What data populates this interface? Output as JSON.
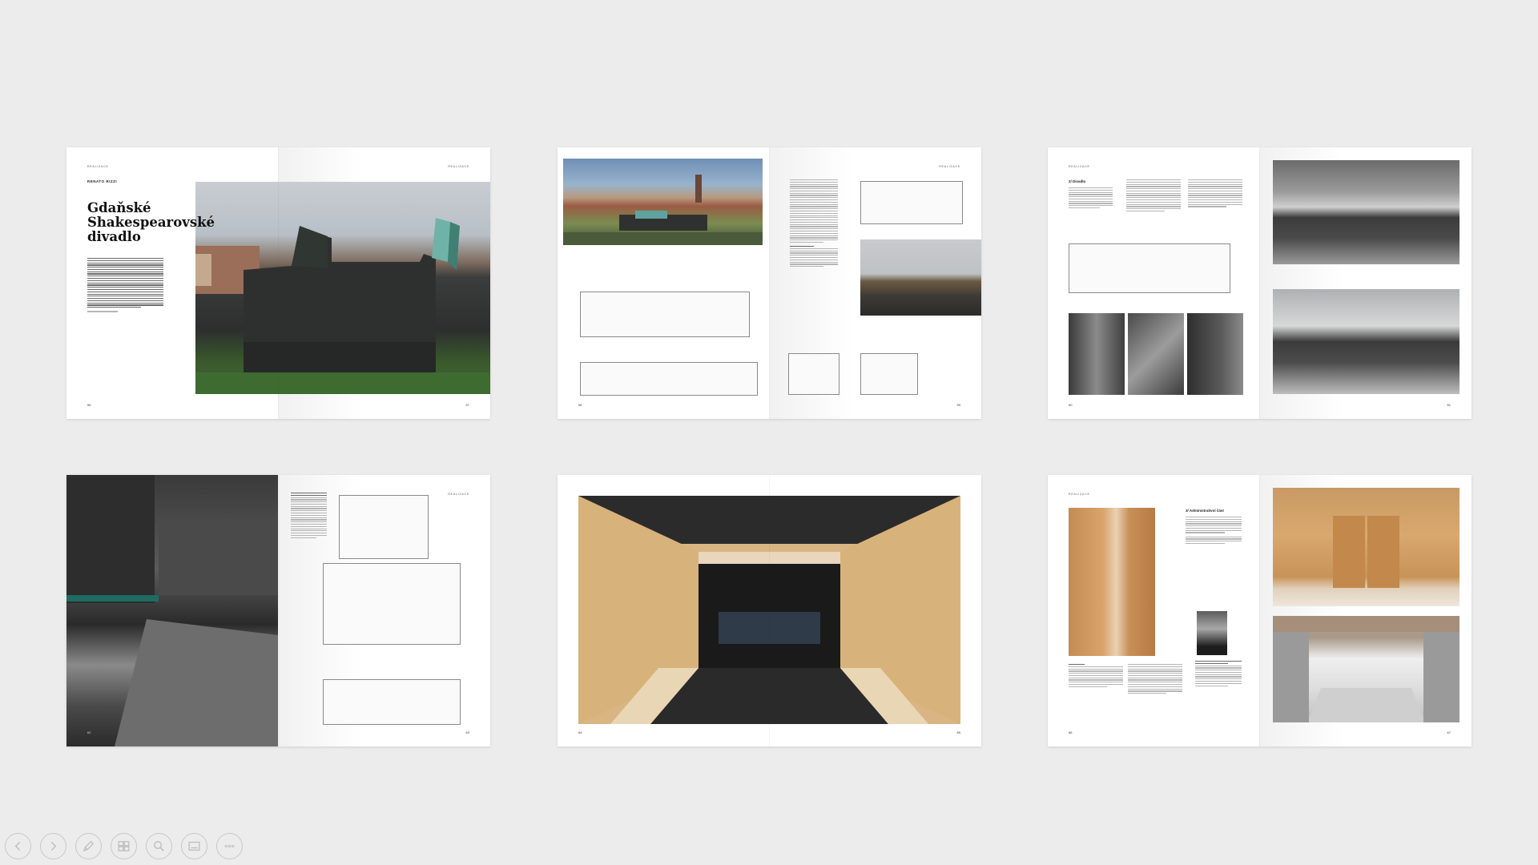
{
  "spreads": [
    {
      "section": "REALIZACE",
      "author": "RENATO RIZZI",
      "title": "Gdaňské\nShakespearovské\ndivadlo",
      "pages": [
        "56",
        "57"
      ]
    },
    {
      "section": "REALIZACE",
      "pages": [
        "58",
        "59"
      ]
    },
    {
      "heading": "2/ Divadlo",
      "pages": [
        "60",
        "61"
      ]
    },
    {
      "section": "REALIZACE",
      "pages": [
        "62",
        "63"
      ]
    },
    {
      "pages": [
        "64",
        "65"
      ]
    },
    {
      "section": "REALIZACE",
      "heading": "3/ Administrativní část",
      "pages": [
        "66",
        "67"
      ]
    }
  ],
  "toolbar": {
    "buttons": [
      {
        "name": "previous-slide-button",
        "icon": "arrow-left-icon"
      },
      {
        "name": "next-slide-button",
        "icon": "arrow-right-icon"
      },
      {
        "name": "pen-tool-button",
        "icon": "pen-icon"
      },
      {
        "name": "slide-overview-button",
        "icon": "grid-icon"
      },
      {
        "name": "zoom-button",
        "icon": "magnifier-icon"
      },
      {
        "name": "subtitles-button",
        "icon": "subtitles-icon"
      },
      {
        "name": "more-options-button",
        "icon": "ellipsis-icon"
      }
    ]
  },
  "colors": {
    "background": "#ececec",
    "page": "#ffffff",
    "toolbar_icon": "#bdbdbd"
  }
}
